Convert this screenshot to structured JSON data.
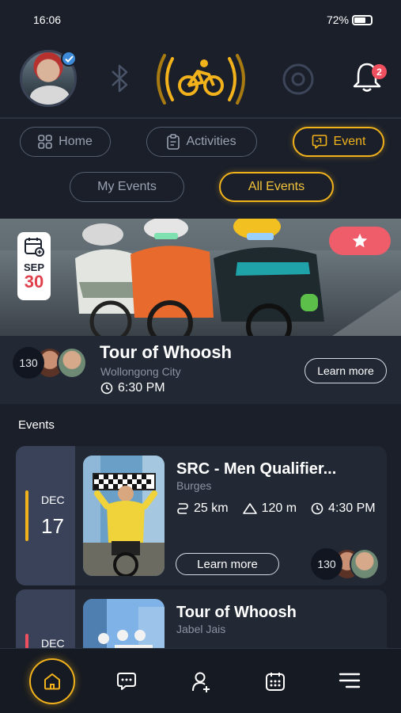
{
  "status": {
    "time": "16:06",
    "battery": "72%"
  },
  "header": {
    "notification_count": "2"
  },
  "tabs": [
    {
      "label": "Home"
    },
    {
      "label": "Activities"
    },
    {
      "label": "Event"
    }
  ],
  "subtabs": [
    {
      "label": "My Events"
    },
    {
      "label": "All Events"
    }
  ],
  "featured": {
    "month": "SEP",
    "day": "30",
    "participants": "130",
    "title": "Tour of Whoosh",
    "location": "Wollongong City",
    "time": "6:30 PM",
    "cta": "Learn more"
  },
  "events_section_title": "Events",
  "events": [
    {
      "month": "DEC",
      "day": "17",
      "title": "SRC - Men Qualifier...",
      "location": "Burges",
      "distance": "25 km",
      "elevation": "120 m",
      "time": "4:30 PM",
      "cta": "Learn more",
      "participants": "130",
      "accent": "#f2b21b"
    },
    {
      "month": "DEC",
      "title": "Tour of Whoosh",
      "location": "Jabel Jais",
      "accent": "#ef4f5e"
    }
  ],
  "colors": {
    "accent": "#f2b21b",
    "alert": "#ef4f5e",
    "background": "#1a1f2a",
    "card": "#222935"
  },
  "icons": [
    "bluetooth-icon",
    "bike-logo-icon",
    "ring-icon",
    "bell-icon",
    "star-icon",
    "calendar-icon",
    "home-icon",
    "chat-icon",
    "add-user-icon",
    "calendar-grid-icon",
    "menu-icon"
  ]
}
